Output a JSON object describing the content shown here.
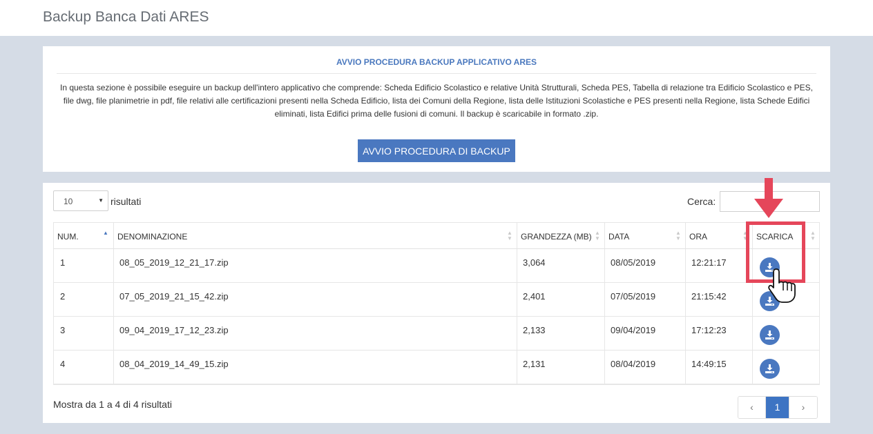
{
  "header": {
    "title": "Backup Banca Dati ARES"
  },
  "procedure": {
    "title": "AVVIO PROCEDURA BACKUP APPLICATIVO ARES",
    "description": "In questa sezione è possibile eseguire un backup dell'intero applicativo che comprende: Scheda Edificio Scolastico e relative Unità Strutturali, Scheda PES, Tabella di relazione tra Edificio Scolastico e PES, file dwg, file planimetrie in pdf, file relativi alle certificazioni presenti nella Scheda Edificio, lista dei Comuni della Regione, lista delle Istituzioni Scolastiche e PES presenti nella Regione, lista Schede Edifici eliminati, lista Edifici prima delle fusioni di comuni. Il backup è scaricabile in formato .zip.",
    "button_label": "AVVIO PROCEDURA DI BACKUP"
  },
  "table_controls": {
    "page_length": "10",
    "page_length_label": "risultati",
    "search_label": "Cerca:",
    "search_value": ""
  },
  "table": {
    "columns": [
      "NUM.",
      "DENOMINAZIONE",
      "GRANDEZZA (MB)",
      "DATA",
      "ORA",
      "SCARICA"
    ],
    "rows": [
      {
        "num": "1",
        "name": "08_05_2019_12_21_17.zip",
        "size": "3,064",
        "date": "08/05/2019",
        "time": "12:21:17"
      },
      {
        "num": "2",
        "name": "07_05_2019_21_15_42.zip",
        "size": "2,401",
        "date": "07/05/2019",
        "time": "21:15:42"
      },
      {
        "num": "3",
        "name": "09_04_2019_17_12_23.zip",
        "size": "2,133",
        "date": "09/04/2019",
        "time": "17:12:23"
      },
      {
        "num": "4",
        "name": "08_04_2019_14_49_15.zip",
        "size": "2,131",
        "date": "08/04/2019",
        "time": "14:49:15"
      }
    ],
    "download_icon": "download-icon"
  },
  "footer": {
    "info": "Mostra da 1 a 4 di 4 risultati",
    "prev": "‹",
    "current_page": "1",
    "next": "›"
  },
  "annotation": {
    "color": "#e5465a",
    "pointer_icon": "hand-pointer-icon"
  },
  "colors": {
    "accent": "#4a78c0",
    "background": "#d5dce6"
  }
}
